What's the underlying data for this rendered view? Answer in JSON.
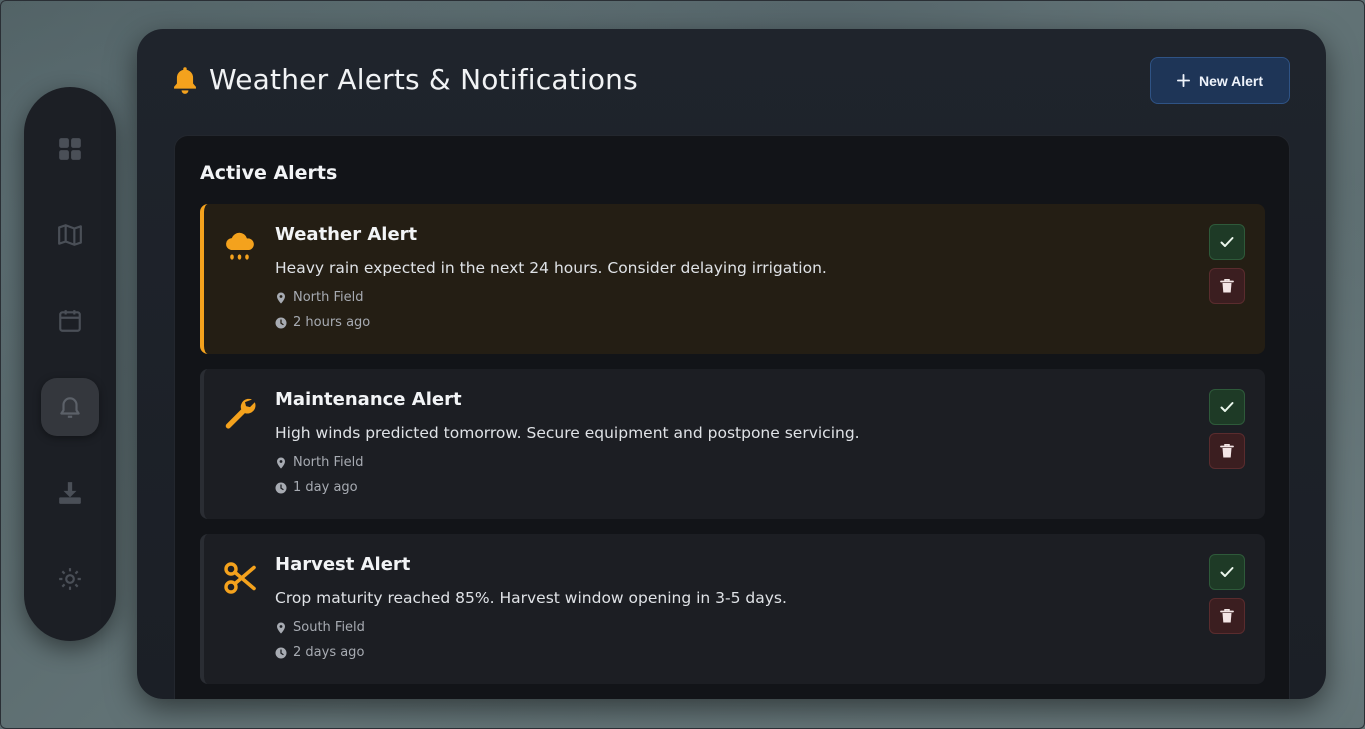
{
  "sidebar": {
    "items": [
      {
        "name": "dashboard",
        "icon": "grid-icon"
      },
      {
        "name": "map",
        "icon": "map-icon"
      },
      {
        "name": "calendar",
        "icon": "calendar-icon"
      },
      {
        "name": "alerts",
        "icon": "bell-icon",
        "active": true
      },
      {
        "name": "download",
        "icon": "download-icon"
      },
      {
        "name": "settings",
        "icon": "gear-icon"
      }
    ]
  },
  "header": {
    "title": "Weather Alerts & Notifications",
    "icon": "bell-icon",
    "new_alert_label": "New Alert"
  },
  "alerts_section": {
    "title": "Active Alerts",
    "alerts": [
      {
        "type": "warning",
        "icon": "cloud-rain-icon",
        "title": "Weather Alert",
        "message": "Heavy rain expected in the next 24 hours. Consider delaying irrigation.",
        "location": "North Field",
        "time": "2 hours ago"
      },
      {
        "type": "info",
        "icon": "wrench-icon",
        "title": "Maintenance Alert",
        "message": "High winds predicted tomorrow. Secure equipment and postpone servicing.",
        "location": "North Field",
        "time": "1 day ago"
      },
      {
        "type": "info",
        "icon": "scissors-icon",
        "title": "Harvest Alert",
        "message": "Crop maturity reached 85%. Harvest window opening in 3-5 days.",
        "location": "South Field",
        "time": "2 days ago"
      }
    ]
  },
  "colors": {
    "accent_amber": "#f4a21d",
    "primary_button": "#1e3557",
    "acknowledge": "#1e3a26",
    "delete": "#3b1e20"
  }
}
